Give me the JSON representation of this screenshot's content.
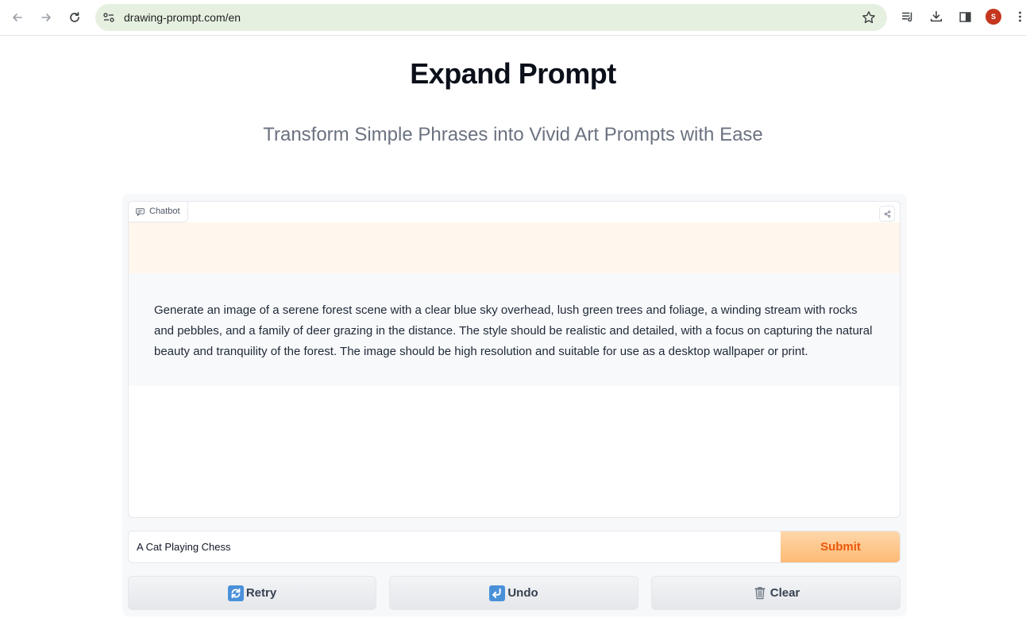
{
  "browser": {
    "url": "drawing-prompt.com/en",
    "profile_initial": "S"
  },
  "header": {
    "title": "Expand Prompt",
    "subtitle": "Transform Simple Phrases into Vivid Art Prompts with Ease"
  },
  "chatbot": {
    "label": "Chatbot",
    "user_message": "",
    "bot_message": "Generate an image of a serene forest scene with a clear blue sky overhead, lush green trees and foliage, a winding stream with rocks and pebbles, and a family of deer grazing in the distance. The style should be realistic and detailed, with a focus on capturing the natural beauty and tranquility of the forest. The image should be high resolution and suitable for use as a desktop wallpaper or print."
  },
  "input": {
    "value": "A Cat Playing Chess",
    "submit_label": "Submit"
  },
  "actions": {
    "retry_label": "Retry",
    "undo_label": "Undo",
    "clear_label": "Clear"
  },
  "colors": {
    "accent_orange": "#ea580c",
    "user_msg_bg": "#fff6ed",
    "avatar": "#c5361e"
  }
}
